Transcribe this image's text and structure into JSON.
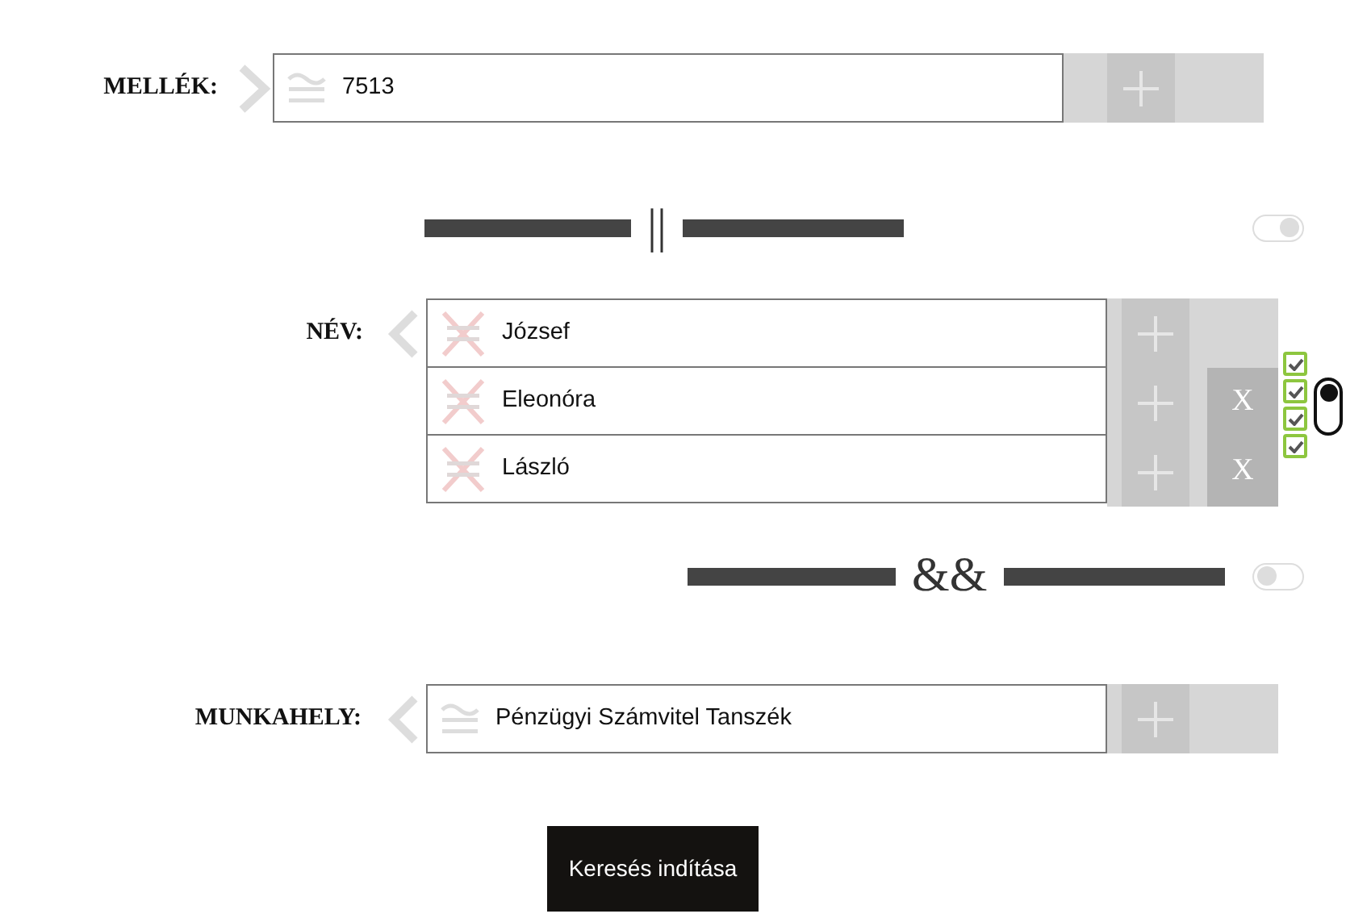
{
  "filters": [
    {
      "kind": "field",
      "label": "MELLÉK:",
      "values": [
        {
          "text": "7513",
          "removable": false
        }
      ]
    },
    {
      "kind": "operator",
      "text": "||",
      "on": true
    },
    {
      "kind": "field",
      "label": "NÉV:",
      "values": [
        {
          "text": "József",
          "removable": false
        },
        {
          "text": "Eleonóra",
          "removable": true,
          "remove": "X"
        },
        {
          "text": "László",
          "removable": true,
          "remove": "X"
        }
      ],
      "checks": [
        {
          "checked": true
        },
        {
          "checked": true
        },
        {
          "checked": true
        },
        {
          "checked": true
        }
      ],
      "switch_on": true
    },
    {
      "kind": "operator",
      "text": "&&",
      "on": false
    },
    {
      "kind": "field",
      "label": "MUNKAHELY:",
      "values": [
        {
          "text": "Pénzügyi Számvitel Tanszék",
          "removable": false
        }
      ]
    }
  ],
  "search_button": "Keresés indítása"
}
